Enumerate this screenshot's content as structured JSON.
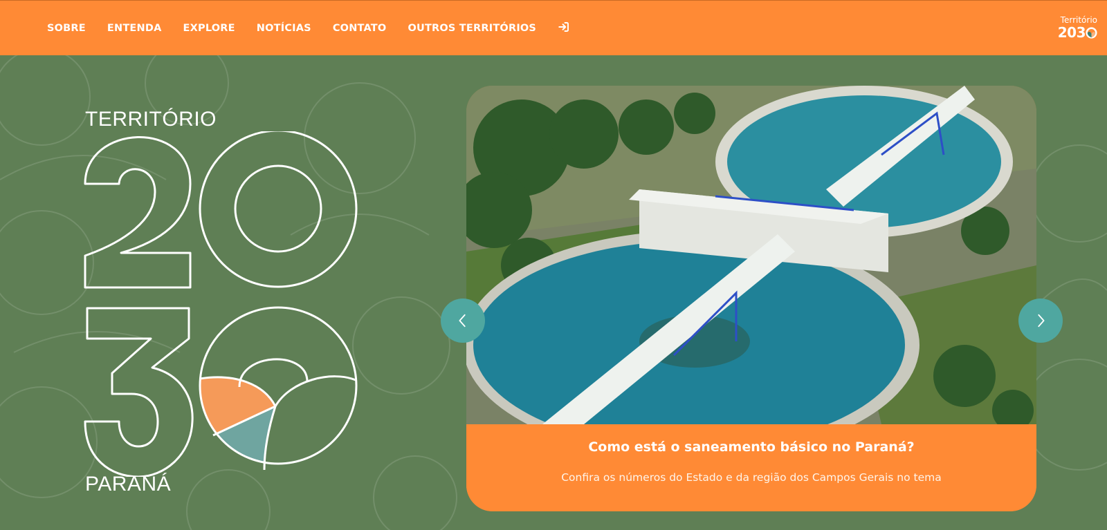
{
  "nav": {
    "items": [
      {
        "label": "SOBRE"
      },
      {
        "label": "ENTENDA"
      },
      {
        "label": "EXPLORE"
      },
      {
        "label": "NOTÍCIAS"
      },
      {
        "label": "CONTATO"
      },
      {
        "label": "OUTROS TERRITÓRIOS"
      }
    ],
    "login_icon": "login-icon"
  },
  "brand": {
    "top": "Território",
    "num_prefix": "203"
  },
  "hero": {
    "top_text": "TERRITÓRIO",
    "number": "2030",
    "bottom_text": "PARANÁ"
  },
  "slide": {
    "title": "Como está o saneamento básico no Paraná?",
    "subtitle": "Confira os números do Estado e da região dos Campos Gerais no tema",
    "image": "aerial-water-treatment-plant"
  },
  "controls": {
    "prev_icon": "chevron-left-icon",
    "next_icon": "chevron-right-icon"
  },
  "colors": {
    "background": "#5f7f55",
    "accent": "#ff8a35",
    "teal": "#4fa7a0",
    "logo_orange": "#f59a59",
    "logo_teal": "#6fa5a0"
  }
}
